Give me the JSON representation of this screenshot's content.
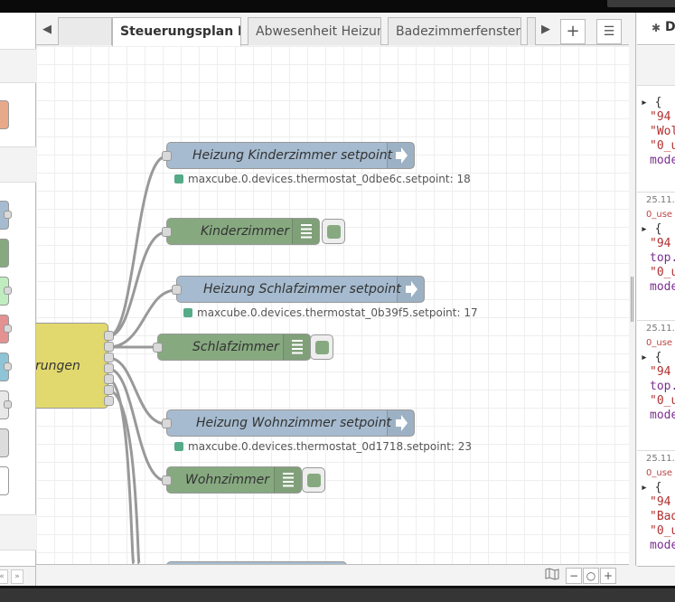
{
  "tabs": [
    {
      "label": "Steuerungsplan He",
      "active": true
    },
    {
      "label": "Abwesenheit Heizun",
      "active": false
    },
    {
      "label": "Badezimmerfenster/",
      "active": false
    }
  ],
  "toolbar": {
    "add_label": "+",
    "menu_label": "☰"
  },
  "sidebar": {
    "tab_label": "D",
    "tab_icon": "bug-icon"
  },
  "nodes": {
    "func": {
      "label": "rungen"
    },
    "kinder_setpoint": {
      "label": "Heizung Kinderzimmer setpoint",
      "status": "maxcube.0.devices.thermostat_0dbe6c.setpoint: 18"
    },
    "kinder_debug": {
      "label": "Kinderzimmer"
    },
    "schlaf_setpoint": {
      "label": "Heizung Schlafzimmer setpoint",
      "status": "maxcube.0.devices.thermostat_0b39f5.setpoint: 17"
    },
    "schlaf_debug": {
      "label": "Schlafzimmer"
    },
    "wohn_setpoint": {
      "label": "Heizung Wohnzimmer setpoint",
      "status": "maxcube.0.devices.thermostat_0d1718.setpoint: 23"
    },
    "wohn_debug": {
      "label": "Wohnzimmer"
    }
  },
  "debug_messages": [
    {
      "lines": [
        [
          "▸ {",
          "punc"
        ],
        [
          "\"94",
          "str"
        ],
        [
          "\"Wol",
          "str"
        ],
        [
          "\"0_u",
          "str"
        ],
        [
          "mode",
          "key"
        ]
      ]
    },
    {
      "meta": "25.11.",
      "topic": "0_use",
      "lines": [
        [
          "▸ {",
          "punc"
        ],
        [
          "\"94",
          "str"
        ],
        [
          "top.",
          "key"
        ],
        [
          "\"0_u",
          "str"
        ],
        [
          "mode",
          "key"
        ]
      ]
    },
    {
      "meta": "25.11.",
      "topic": "0_use",
      "lines": [
        [
          "▸ {",
          "punc"
        ],
        [
          "\"94",
          "str"
        ],
        [
          "top.",
          "key"
        ],
        [
          "\"0_u",
          "str"
        ],
        [
          "mode",
          "key"
        ]
      ]
    },
    {
      "meta": "25.11.",
      "topic": "0_use",
      "lines": [
        [
          "▸ {",
          "punc"
        ],
        [
          "\"94",
          "str"
        ],
        [
          "\"Bad",
          "str"
        ],
        [
          "\"0_u",
          "str"
        ],
        [
          "mode",
          "key"
        ]
      ]
    }
  ],
  "footer": {
    "zoom_out": "−",
    "zoom_reset": "○",
    "zoom_in": "+",
    "palette_up": "«",
    "palette_down": "»"
  },
  "colors": {
    "mqtt": "#a6bbcf",
    "debug": "#87a980",
    "function": "#e2d96e",
    "status_connected": "#5a8"
  }
}
